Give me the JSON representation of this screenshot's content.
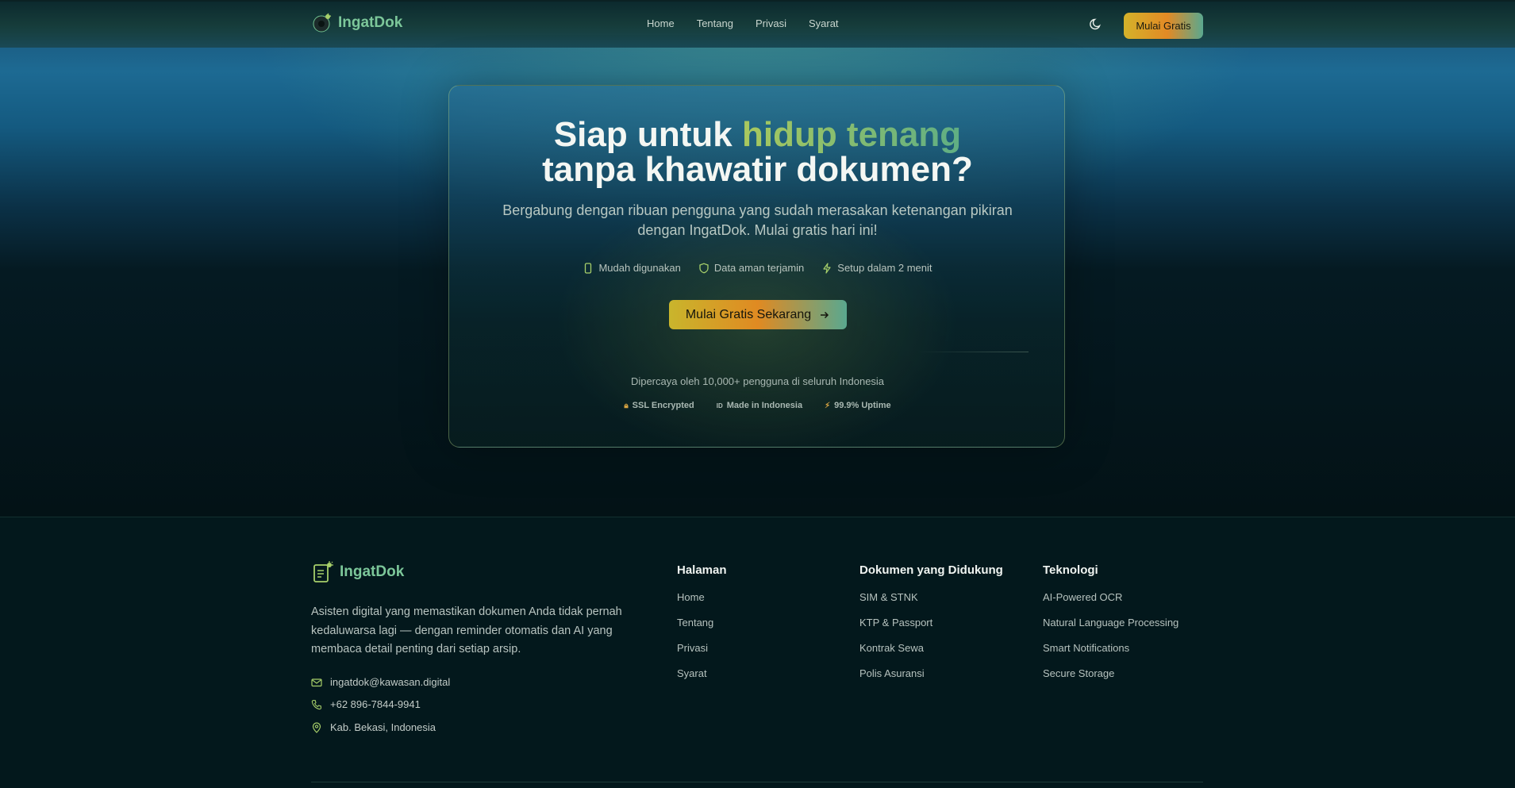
{
  "brand": {
    "name": "IngatDok"
  },
  "nav": {
    "links": [
      "Home",
      "Tentang",
      "Privasi",
      "Syarat"
    ],
    "cta": "Mulai Gratis"
  },
  "hero": {
    "title_part1": "Siap untuk",
    "title_accent": "hidup tenang",
    "title_part2": "tanpa khawatir dokumen?",
    "subtitle": "Bergabung dengan ribuan pengguna yang sudah merasakan ketenangan pikiran dengan IngatDok. Mulai gratis hari ini!",
    "features": [
      {
        "label": "Mudah digunakan",
        "icon": "smartphone-icon"
      },
      {
        "label": "Data aman terjamin",
        "icon": "shield-icon"
      },
      {
        "label": "Setup dalam 2 menit",
        "icon": "zap-icon"
      }
    ],
    "cta": "Mulai Gratis Sekarang",
    "trust_text": "Dipercaya oleh 10,000+ pengguna di seluruh Indonesia",
    "badges": [
      {
        "label": "SSL Encrypted",
        "icon": "lock-icon"
      },
      {
        "label": "Made in Indonesia",
        "icon": "id-flag-icon",
        "glyph": "ID"
      },
      {
        "label": "99.9% Uptime",
        "icon": "bolt-icon"
      }
    ]
  },
  "footer": {
    "description": "Asisten digital yang memastikan dokumen Anda tidak pernah kedaluwarsa lagi — dengan reminder otomatis dan AI yang membaca detail penting dari setiap arsip.",
    "contact": {
      "email": "ingatdok@kawasan.digital",
      "phone": "+62 896-7844-9941",
      "location": "Kab. Bekasi, Indonesia"
    },
    "columns": [
      {
        "title": "Halaman",
        "items": [
          "Home",
          "Tentang",
          "Privasi",
          "Syarat"
        ]
      },
      {
        "title": "Dokumen yang Didukung",
        "items": [
          "SIM & STNK",
          "KTP & Passport",
          "Kontrak Sewa",
          "Polis Asuransi"
        ]
      },
      {
        "title": "Teknologi",
        "items": [
          "AI-Powered OCR",
          "Natural Language Processing",
          "Smart Notifications",
          "Secure Storage"
        ]
      }
    ]
  },
  "colors": {
    "accent_green": "#7cc79a",
    "cta_gradient": [
      "#c9b52c",
      "#e08a22",
      "#5aa88f"
    ],
    "footer_bg": "#03181c"
  }
}
